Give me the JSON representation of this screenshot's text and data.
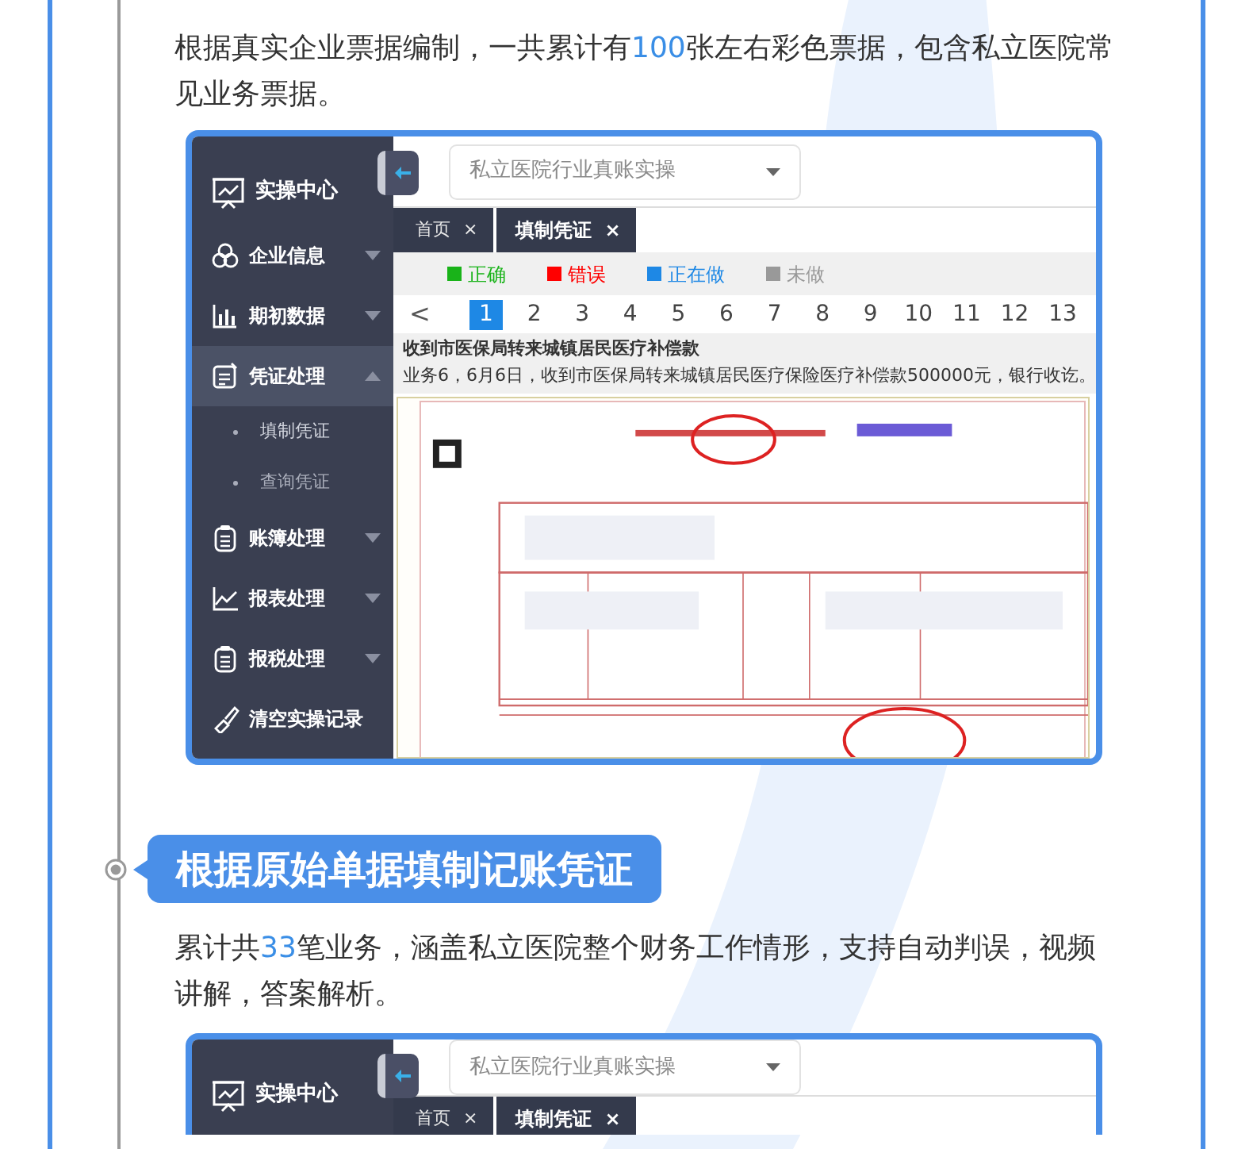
{
  "blocks": [
    {
      "kind": "paragraph",
      "parts": [
        {
          "text": "根据真实企业票据编制，一共累计有",
          "highlight": false
        },
        {
          "text": "100",
          "highlight": true
        },
        {
          "text": "张左右彩色票据，包含私立医院常见业务票据。",
          "highlight": false
        }
      ]
    },
    {
      "kind": "app",
      "sidebar": {
        "title": "实操中心",
        "items": [
          {
            "kind": "group",
            "label": "企业信息",
            "expanded": false,
            "selected": false
          },
          {
            "kind": "group",
            "label": "期初数据",
            "expanded": false,
            "selected": false
          },
          {
            "kind": "group",
            "label": "凭证处理",
            "expanded": true,
            "selected": true,
            "children": [
              {
                "label": "填制凭证",
                "selected": true
              },
              {
                "label": "查询凭证",
                "selected": false
              }
            ]
          },
          {
            "kind": "group",
            "label": "账簿处理",
            "expanded": false,
            "selected": false
          },
          {
            "kind": "group",
            "label": "报表处理",
            "expanded": false,
            "selected": false
          },
          {
            "kind": "group",
            "label": "报税处理",
            "expanded": false,
            "selected": false
          },
          {
            "kind": "action",
            "label": "清空实操记录",
            "selected": false
          }
        ]
      },
      "select": {
        "value": "私立医院行业真账实操"
      },
      "tabs": [
        {
          "label": "首页",
          "close": "×",
          "selected": false
        },
        {
          "label": "填制凭证",
          "close": "×",
          "selected": true
        }
      ],
      "legend": [
        {
          "label": "正确",
          "color": "#19b319"
        },
        {
          "label": "错误",
          "color": "#ff0000"
        },
        {
          "label": "正在做",
          "color": "#1e88e5"
        },
        {
          "label": "未做",
          "color": "#999999"
        }
      ],
      "pager": {
        "prev": "<",
        "pages": [
          {
            "label": "1",
            "selected": true
          },
          {
            "label": "2",
            "selected": false
          },
          {
            "label": "3",
            "selected": false
          },
          {
            "label": "4",
            "selected": false
          },
          {
            "label": "5",
            "selected": false
          },
          {
            "label": "6",
            "selected": false
          },
          {
            "label": "7",
            "selected": false
          },
          {
            "label": "8",
            "selected": false
          },
          {
            "label": "9",
            "selected": false
          },
          {
            "label": "10",
            "selected": false
          },
          {
            "label": "11",
            "selected": false
          },
          {
            "label": "12",
            "selected": false
          },
          {
            "label": "13",
            "selected": false
          }
        ]
      },
      "task": {
        "title": "收到市医保局转来城镇居民医疗补偿款",
        "description": "业务6，6月6日，收到市医保局转来城镇居民医疗保险医疗补偿款500000元，银行收讫。"
      },
      "document": {
        "kind": "picture"
      }
    },
    {
      "kind": "heading",
      "text": "根据原始单据填制记账凭证"
    },
    {
      "kind": "paragraph",
      "parts": [
        {
          "text": "累计共",
          "highlight": false
        },
        {
          "text": "33",
          "highlight": true
        },
        {
          "text": "笔业务，涵盖私立医院整个财务工作情形，支持自动判误，视频讲解，答案解析。",
          "highlight": false
        }
      ]
    },
    {
      "kind": "app",
      "sidebar": {
        "title": "实操中心"
      },
      "select": {
        "value": "私立医院行业真账实操"
      },
      "tabs": [
        {
          "label": "首页",
          "close": "×",
          "selected": false
        },
        {
          "label": "填制凭证",
          "close": "×",
          "selected": true
        }
      ]
    }
  ]
}
